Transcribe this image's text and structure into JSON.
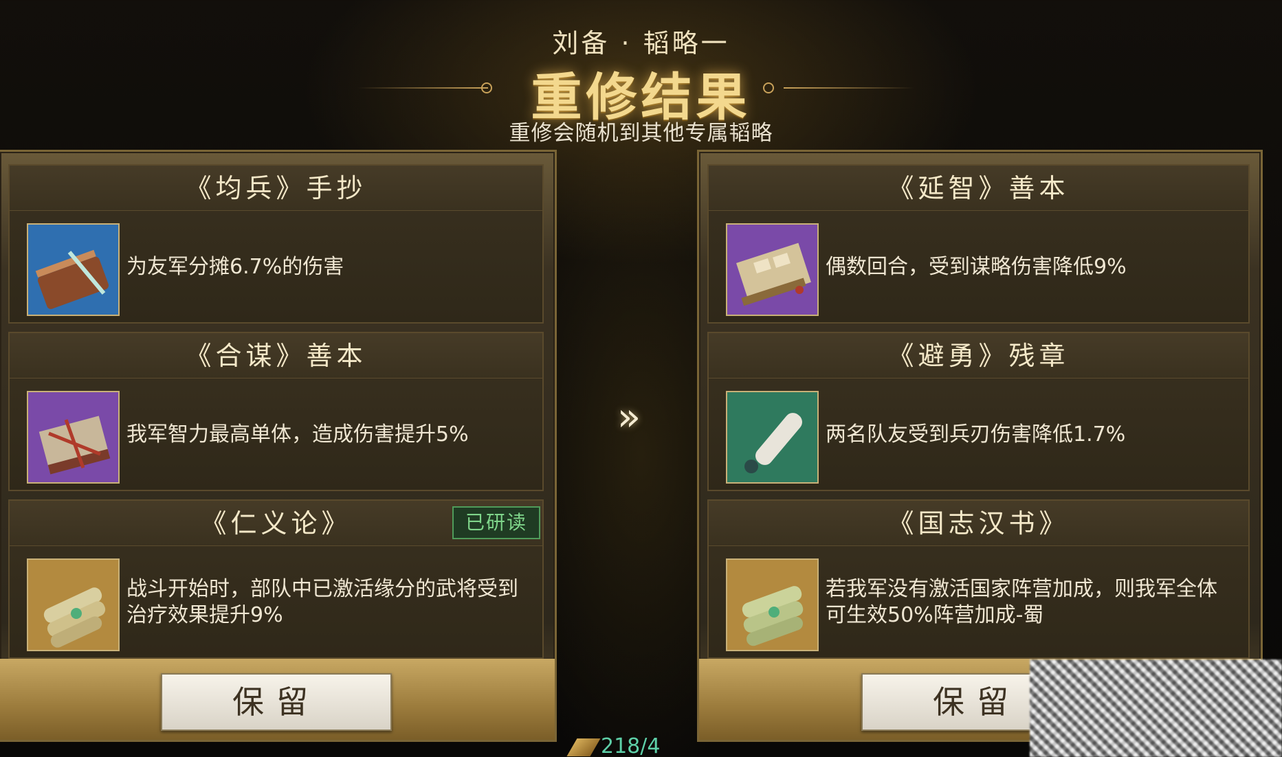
{
  "header": {
    "subtitle": "刘备 · 韬略一",
    "title": "重修结果",
    "hint": "重修会随机到其他专属韬略"
  },
  "left_panel": {
    "cards": [
      {
        "title": "《均兵》手抄",
        "description": "为友军分摊6.7%的伤害",
        "icon": "bamboo-scroll-icon",
        "icon_bg": "#2f6fb0"
      },
      {
        "title": "《合谋》善本",
        "description": "我军智力最高单体，造成伤害提升5%",
        "icon": "tied-books-icon",
        "icon_bg": "#7a4aa8"
      },
      {
        "title": "《仁义论》",
        "description": "战斗开始时，部队中已激活缘分的武将受到治疗效果提升9%",
        "icon": "scroll-bundle-icon",
        "icon_bg": "#b38a3f",
        "badge": "已研读"
      }
    ],
    "keep_label": "保留"
  },
  "right_panel": {
    "cards": [
      {
        "title": "《延智》善本",
        "description": "偶数回合，受到谋略伤害降低9%",
        "icon": "book-scroll-icon",
        "icon_bg": "#7a4aa8"
      },
      {
        "title": "《避勇》残章",
        "description": "两名队友受到兵刃伤害降低1.7%",
        "icon": "paper-roll-icon",
        "icon_bg": "#2f7a5e"
      },
      {
        "title": "《国志汉书》",
        "description": "若我军没有激活国家阵营加成，则我军全体可生效50%阵营加成-蜀",
        "icon": "scroll-bundle-icon",
        "icon_bg": "#b38a3f"
      }
    ],
    "keep_label": "保留"
  },
  "compare_arrow": "»",
  "currency": {
    "icon": "currency-icon",
    "value": "218/4"
  }
}
